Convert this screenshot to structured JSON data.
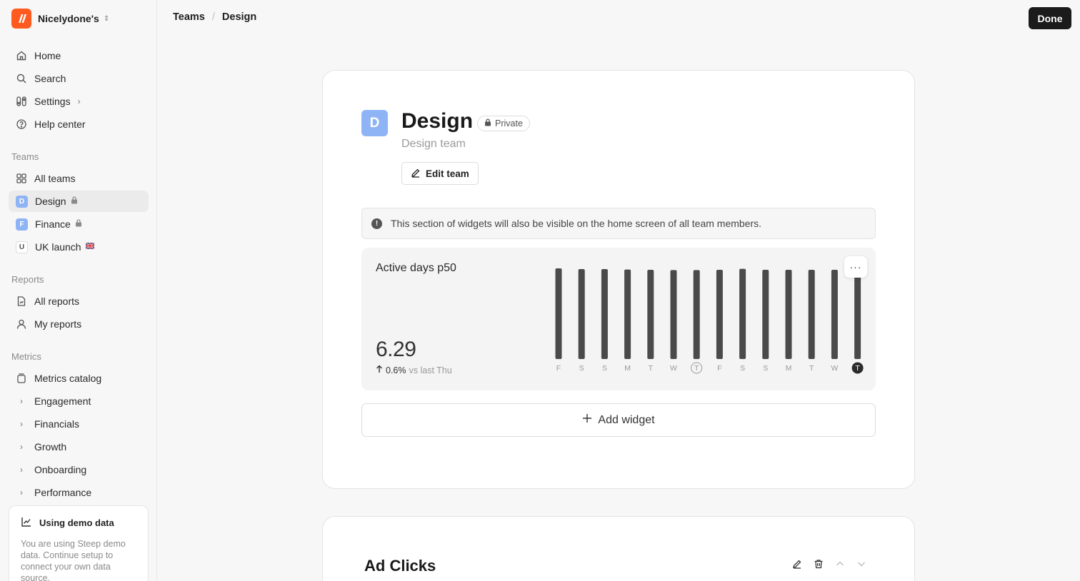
{
  "workspace": {
    "name": "Nicelydone's"
  },
  "nav": [
    {
      "label": "Home",
      "icon": "home-icon"
    },
    {
      "label": "Search",
      "icon": "search-icon"
    },
    {
      "label": "Settings",
      "icon": "settings-icon"
    },
    {
      "label": "Help center",
      "icon": "help-icon"
    }
  ],
  "teams_section": {
    "label": "Teams",
    "all": "All teams",
    "items": [
      {
        "label": "Design",
        "initial": "D",
        "color": "#8fb4f5"
      },
      {
        "label": "Finance",
        "initial": "F",
        "color": "#8fb4f5"
      },
      {
        "label": "UK launch",
        "initial": "U",
        "color": "#ffffff"
      }
    ]
  },
  "reports_section": {
    "label": "Reports",
    "items": [
      {
        "label": "All reports"
      },
      {
        "label": "My reports"
      }
    ]
  },
  "metrics_section": {
    "label": "Metrics",
    "catalog": "Metrics catalog",
    "groups": [
      "Engagement",
      "Financials",
      "Growth",
      "Onboarding",
      "Performance"
    ]
  },
  "demo": {
    "title": "Using demo data",
    "body": "You are using Steep demo data. Continue setup to connect your own data source."
  },
  "breadcrumb": {
    "parent": "Teams",
    "current": "Design"
  },
  "done_label": "Done",
  "team": {
    "initial": "D",
    "name": "Design",
    "visibility": "Private",
    "description": "Design team",
    "edit_label": "Edit team"
  },
  "notice": "This section of widgets will also be visible on the home screen of all team members.",
  "widget": {
    "title": "Active days p50",
    "value": "6.29",
    "delta": "0.6%",
    "delta_suffix": "vs last Thu",
    "more_label": "···"
  },
  "chart_data": {
    "type": "bar",
    "categories": [
      "F",
      "S",
      "S",
      "M",
      "T",
      "W",
      "T",
      "F",
      "S",
      "S",
      "M",
      "T",
      "W",
      "T"
    ],
    "values": [
      6.3,
      6.25,
      6.25,
      6.22,
      6.2,
      6.18,
      6.18,
      6.2,
      6.27,
      6.2,
      6.2,
      6.2,
      6.2,
      6.29
    ],
    "circled_ticks": [
      6,
      13
    ],
    "filled_tick": 13,
    "bar_color": "#4a4a4a",
    "ylim": [
      0,
      6.35
    ]
  },
  "add_widget_label": "Add widget",
  "second_card": {
    "title": "Ad Clicks"
  }
}
